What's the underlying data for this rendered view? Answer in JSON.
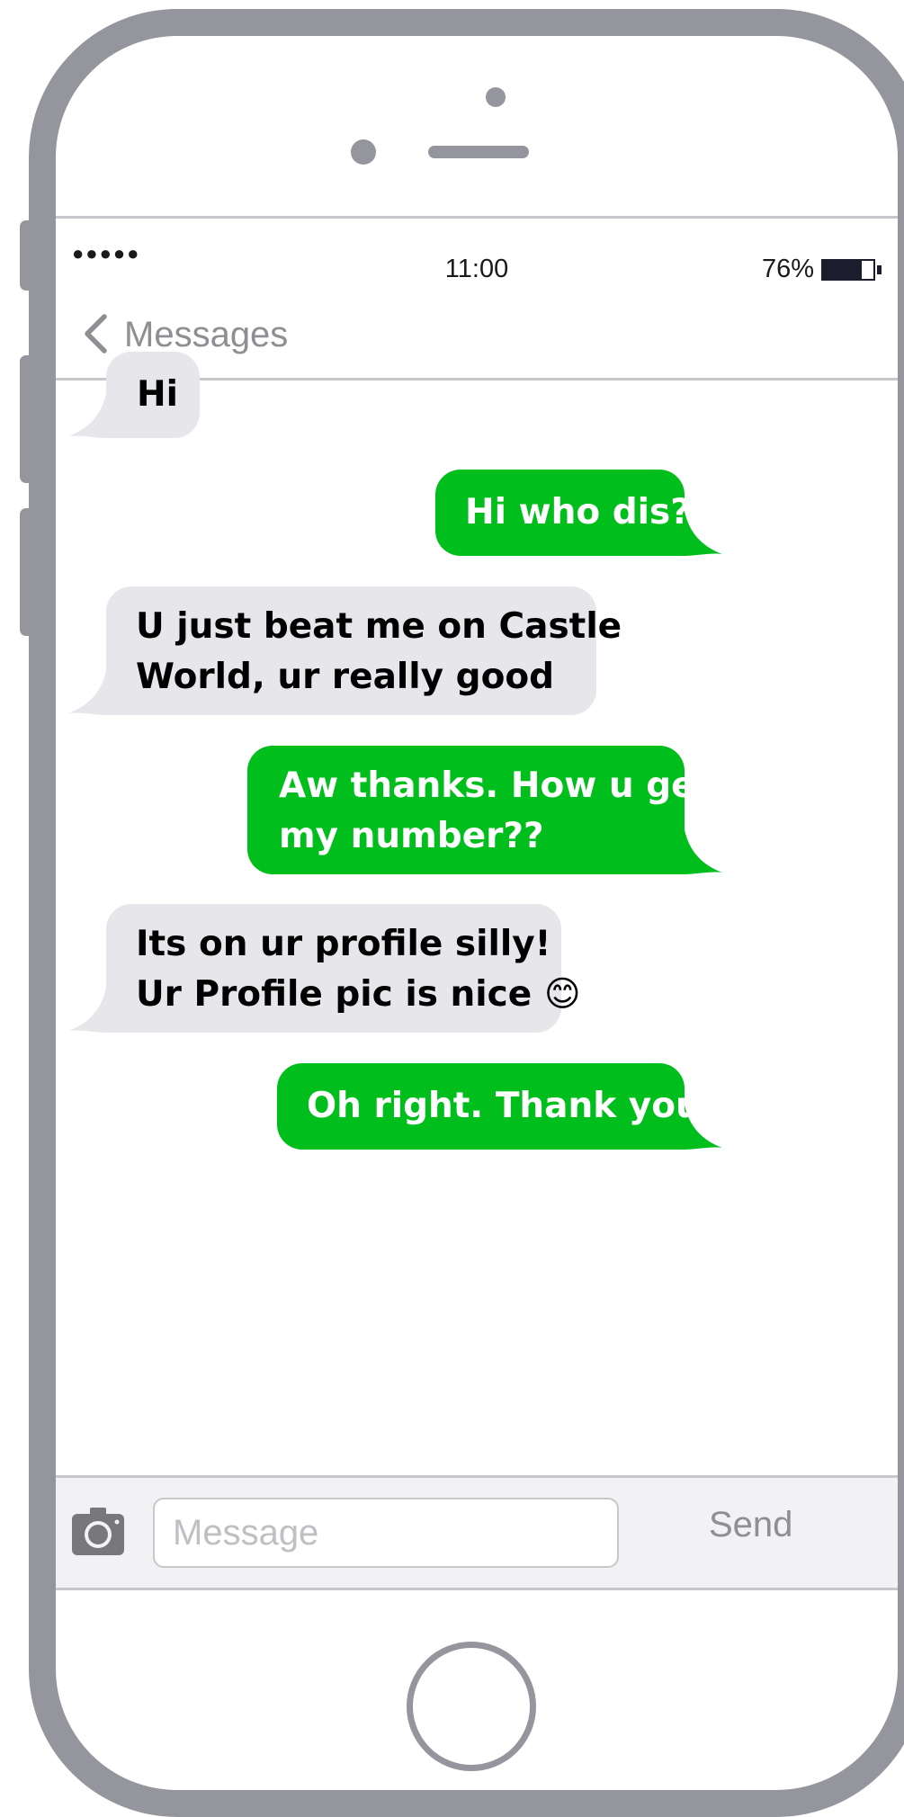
{
  "status_bar": {
    "signal": "●●●●●",
    "time": "11:00",
    "battery_percent": "76%",
    "battery_level": 0.76
  },
  "nav": {
    "back_label": "Messages",
    "back_icon": "chevron-left-icon"
  },
  "messages": [
    {
      "direction": "incoming",
      "text": "Hi"
    },
    {
      "direction": "outgoing",
      "text": "Hi who dis?"
    },
    {
      "direction": "incoming",
      "lines": [
        "U just beat me on Castle",
        "World, ur really good"
      ]
    },
    {
      "direction": "outgoing",
      "lines": [
        "Aw thanks. How u get",
        "my number??"
      ]
    },
    {
      "direction": "incoming",
      "lines": [
        "Its on ur profile silly!",
        "Ur Profile pic is nice 😊"
      ]
    },
    {
      "direction": "outgoing",
      "text": "Oh right. Thank you"
    }
  ],
  "composer": {
    "camera_icon": "camera-icon",
    "placeholder": "Message",
    "value": "",
    "send_label": "Send"
  },
  "colors": {
    "frame": "#94959d",
    "incoming_bubble": "#e6e6eb",
    "outgoing_bubble": "#00be1c",
    "muted_text": "#8e8e93"
  }
}
